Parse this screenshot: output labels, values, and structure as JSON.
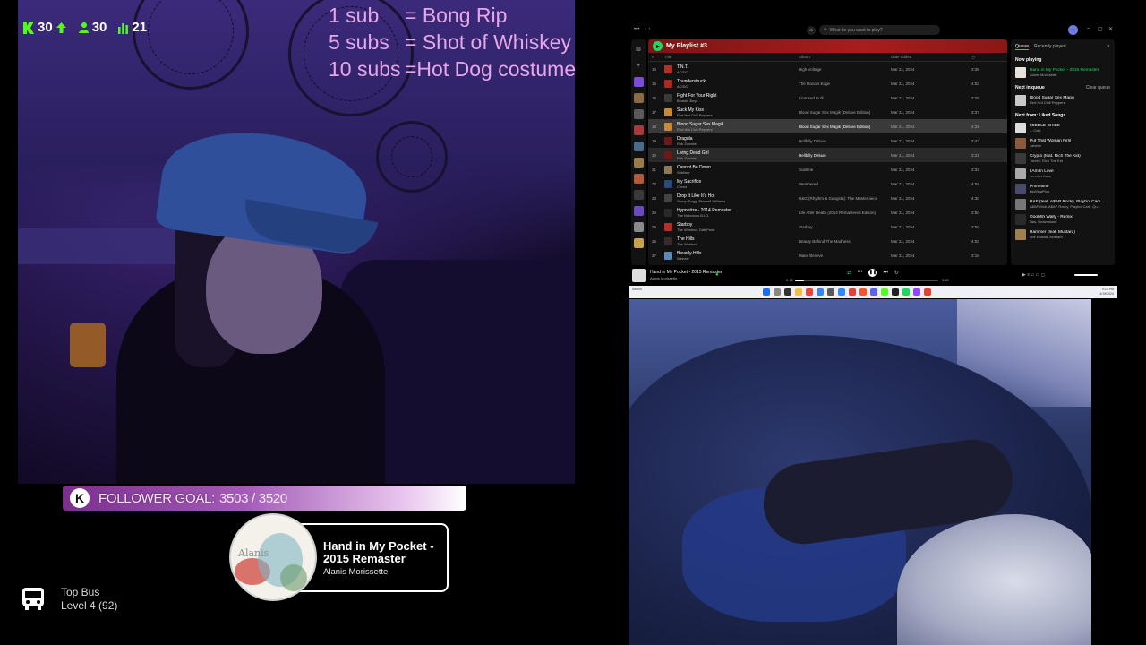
{
  "stats": {
    "kick_followers": "30",
    "active_chatters": "30",
    "viewers": "21"
  },
  "sub_goals": [
    {
      "left": "1 sub",
      "right": "= Bong Rip"
    },
    {
      "left": "5 subs",
      "right": "= Shot of Whiskey"
    },
    {
      "left": "10 subs",
      "right": "=Hot Dog costume"
    }
  ],
  "follower_goal": {
    "badge": "K",
    "label": "FOLLOWER GOAL:",
    "value": "3503 / 3520",
    "progress": 0.995
  },
  "now_playing": {
    "title": "Hand in My Pocket - 2015 Remaster",
    "artist": "Alanis Morissette",
    "disc_text": "Alanis"
  },
  "top_bus": {
    "title": "Top Bus",
    "level": "Level 4  (92)"
  },
  "spotify": {
    "search_placeholder": "What do you want to play?",
    "playlist_name": "My Playlist #3",
    "columns": {
      "num": "#",
      "title": "Title",
      "album": "Album",
      "date": "Date added",
      "duration": "◷"
    },
    "tracks": [
      {
        "num": "14",
        "title": "T.N.T.",
        "artist": "AC/DC",
        "album": "High Voltage",
        "date": "Mar 21, 2024",
        "duration": "3:35",
        "state": ""
      },
      {
        "num": "15",
        "title": "Thunderstruck",
        "artist": "AC/DC",
        "album": "The Razors Edge",
        "date": "Mar 21, 2024",
        "duration": "4:52",
        "state": ""
      },
      {
        "num": "16",
        "title": "Fight For Your Right",
        "artist": "Beastie Boys",
        "album": "Licensed to Ill",
        "date": "Mar 21, 2024",
        "duration": "3:28",
        "state": ""
      },
      {
        "num": "17",
        "title": "Suck My Kiss",
        "artist": "Red Hot Chili Peppers",
        "album": "Blood Sugar Sex Magik (Deluxe Edition)",
        "date": "Mar 21, 2024",
        "duration": "3:37",
        "state": ""
      },
      {
        "num": "18",
        "title": "Blood Sugar Sex Magik",
        "artist": "Red Hot Chili Peppers",
        "album": "Blood Sugar Sex Magik (Deluxe Edition)",
        "date": "Mar 21, 2024",
        "duration": "4:31",
        "state": "sel"
      },
      {
        "num": "19",
        "title": "Dragula",
        "artist": "Rob Zombie",
        "album": "Hellbilly Deluxe",
        "date": "Mar 21, 2024",
        "duration": "3:43",
        "state": ""
      },
      {
        "num": "20",
        "title": "Living Dead Girl",
        "artist": "Rob Zombie",
        "album": "Hellbilly Deluxe",
        "date": "Mar 21, 2024",
        "duration": "3:21",
        "state": "hov"
      },
      {
        "num": "21",
        "title": "Cannot Be Down",
        "artist": "Sublime",
        "album": "Sublime",
        "date": "Mar 21, 2024",
        "duration": "3:32",
        "state": ""
      },
      {
        "num": "22",
        "title": "My Sacrifice",
        "artist": "Creed",
        "album": "Weathered",
        "date": "Mar 21, 2024",
        "duration": "4:55",
        "state": ""
      },
      {
        "num": "23",
        "title": "Drop It Like It's Hot",
        "artist": "Snoop Dogg, Pharrell Williams",
        "album": "R&G (Rhythm & Gangsta): The Masterpiece",
        "date": "Mar 21, 2024",
        "duration": "4:30",
        "state": ""
      },
      {
        "num": "24",
        "title": "Hypnotize - 2014 Remaster",
        "artist": "The Notorious B.I.G.",
        "album": "Life After Death (2014 Remastered Edition)",
        "date": "Mar 21, 2024",
        "duration": "3:50",
        "state": ""
      },
      {
        "num": "25",
        "title": "Starboy",
        "artist": "The Weeknd, Daft Punk",
        "album": "Starboy",
        "date": "Mar 21, 2024",
        "duration": "3:50",
        "state": ""
      },
      {
        "num": "26",
        "title": "The Hills",
        "artist": "The Weeknd",
        "album": "Beauty Behind The Madness",
        "date": "Mar 21, 2024",
        "duration": "4:02",
        "state": ""
      },
      {
        "num": "27",
        "title": "Beverly Hills",
        "artist": "Weezer",
        "album": "Make Believe",
        "date": "Mar 21, 2024",
        "duration": "3:16",
        "state": ""
      }
    ],
    "queue": {
      "tab_queue": "Queue",
      "tab_recent": "Recently played",
      "now_playing_label": "Now playing",
      "now_playing": {
        "title": "Hand in My Pocket - 2015 Remaster",
        "artist": "Alanis Morissette"
      },
      "next_label": "Next in queue",
      "clear_label": "Clear queue",
      "next": {
        "title": "Blood Sugar Sex Magik",
        "artist": "Red Hot Chili Peppers"
      },
      "from_label": "Next from: Liked Songs",
      "items": [
        {
          "title": "MIDDLE CHILD",
          "artist": "J. Cole"
        },
        {
          "title": "Put That Woman First",
          "artist": "Jaheim"
        },
        {
          "title": "Crypto (feat. Rich The Kid)",
          "artist": "Tohrell, Rich The Kid"
        },
        {
          "title": "I Am In Love",
          "artist": "Jennifer Lane"
        },
        {
          "title": "Primetime",
          "artist": "BigXthaPlug"
        },
        {
          "title": "RAF (feat. A$AP Rocky, Playboi Carti...",
          "artist": "A$AP Mob, A$AP Rocky, Playboi Carti, Qu..."
        },
        {
          "title": "Ooohhh Wally - Remix",
          "artist": "Nas, Brownstone"
        },
        {
          "title": "Rammer (feat. Mustard)",
          "artist": "Wiz Khalifa, Mustard"
        }
      ]
    },
    "player": {
      "title": "Hand in My Pocket - 2015 Remaster",
      "artist": "Alanis Morissette",
      "elapsed": "0:12",
      "total": "3:42",
      "progress": 0.06
    }
  },
  "taskbar": {
    "search_label": "Search",
    "clock_time": "9:14 PM",
    "clock_date": "4/19/2024"
  }
}
